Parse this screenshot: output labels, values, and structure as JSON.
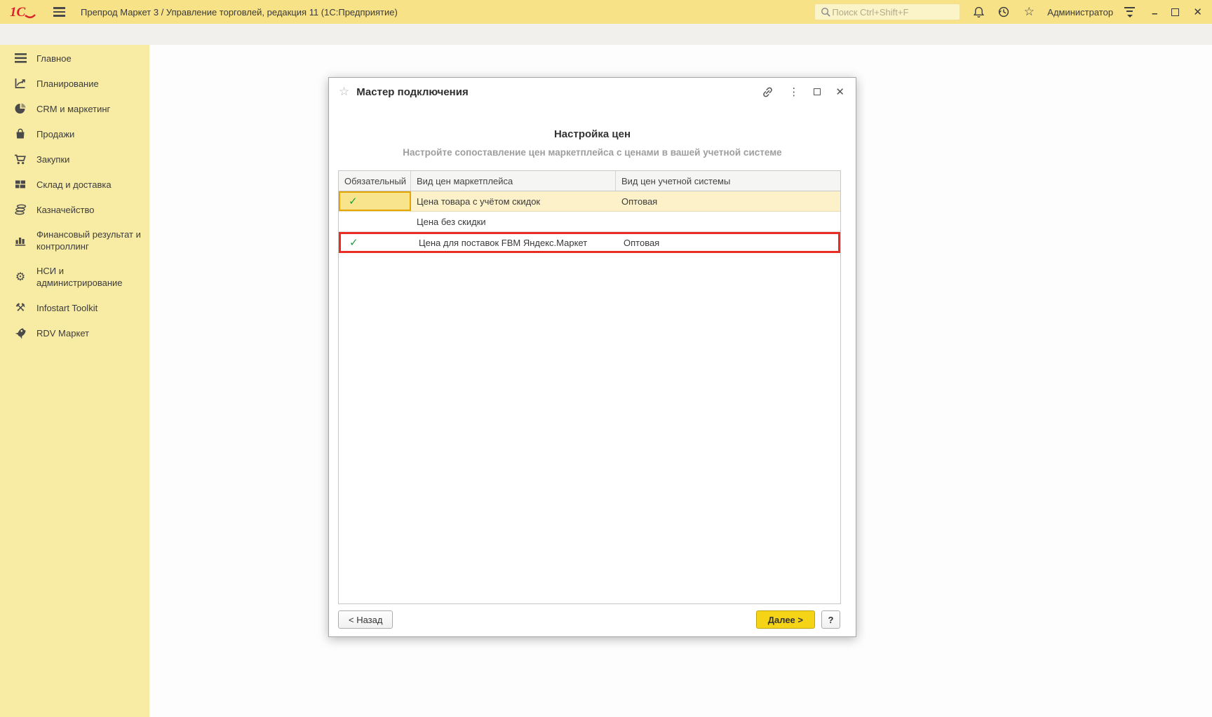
{
  "topbar": {
    "logo_text": "1С",
    "app_title": "Препрод Маркет 3 / Управление торговлей, редакция 11  (1С:Предприятие)",
    "search_placeholder": "Поиск Ctrl+Shift+F",
    "user_name": "Администратор"
  },
  "glyphs": {
    "favorites_star": "☆",
    "dialog_star": "☆",
    "dots_menu": "⋮",
    "close": "✕",
    "minimize": "–",
    "gear": "⚙",
    "tools": "⚒"
  },
  "sidebar": {
    "items": [
      {
        "label": "Главное",
        "icon": "menu-lines-icon"
      },
      {
        "label": "Планирование",
        "icon": "planning-chart-icon"
      },
      {
        "label": "CRM и маркетинг",
        "icon": "pie-chart-icon"
      },
      {
        "label": "Продажи",
        "icon": "bag-icon"
      },
      {
        "label": "Закупки",
        "icon": "cart-icon"
      },
      {
        "label": "Склад и доставка",
        "icon": "warehouse-icon"
      },
      {
        "label": "Казначейство",
        "icon": "coins-icon"
      },
      {
        "label": "Финансовый результат и контроллинг",
        "icon": "bar-chart-icon"
      },
      {
        "label": "НСИ и администрирование",
        "icon": "gear-icon"
      },
      {
        "label": "Infostart Toolkit",
        "icon": "tools-icon"
      },
      {
        "label": "RDV Маркет",
        "icon": "rocket-icon"
      }
    ]
  },
  "dialog": {
    "title": "Мастер подключения",
    "heading": "Настройка цен",
    "subheading": "Настройте сопоставление цен маркетплейса с ценами в вашей учетной системе",
    "table": {
      "columns": [
        "Обязательный",
        "Вид цен маркетплейса",
        "Вид цен учетной системы"
      ],
      "rows": [
        {
          "check": "✓",
          "marketplace": "Цена товара с учётом скидок",
          "system": "Оптовая",
          "state": "selected-yellow"
        },
        {
          "check": "",
          "marketplace": "Цена без скидки",
          "system": "",
          "state": "plain"
        },
        {
          "check": "✓",
          "marketplace": "Цена для поставок FBM Яндекс.Маркет",
          "system": "Оптовая",
          "state": "red-outline"
        }
      ]
    },
    "buttons": {
      "back": "< Назад",
      "next": "Далее >",
      "help": "?"
    }
  },
  "colors": {
    "topbar_yellow": "#f8e287",
    "sidebar_yellow": "#f8eba3",
    "row_highlight": "#fcf1c9",
    "focus_cell_fill": "#f8e48d",
    "focus_cell_border": "#e5a500",
    "red_highlight": "#ea2d24",
    "check_green": "#1e9e3e",
    "next_button_yellow": "#f5d317",
    "logo_red": "#d8232a"
  }
}
